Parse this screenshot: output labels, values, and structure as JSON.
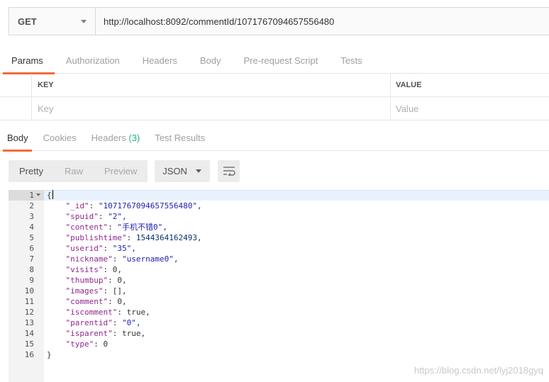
{
  "request": {
    "method": "GET",
    "url": "http://localhost:8092/commentId/1071767094657556480"
  },
  "request_tabs": [
    "Params",
    "Authorization",
    "Headers",
    "Body",
    "Pre-request Script",
    "Tests"
  ],
  "params_table": {
    "key_header": "KEY",
    "value_header": "VALUE",
    "key_placeholder": "Key",
    "value_placeholder": "Value"
  },
  "response_tabs": {
    "body": "Body",
    "cookies": "Cookies",
    "headers": "Headers",
    "headers_count": "(3)",
    "test_results": "Test Results"
  },
  "view_modes": [
    "Pretty",
    "Raw",
    "Preview"
  ],
  "format": "JSON",
  "response_lines": [
    {
      "n": "1",
      "k": "",
      "v": "{",
      "t": "p"
    },
    {
      "n": "2",
      "k": "\"_id\"",
      "v": "\"1071767094657556480\",",
      "t": "s"
    },
    {
      "n": "3",
      "k": "\"spuid\"",
      "v": "\"2\",",
      "t": "s"
    },
    {
      "n": "4",
      "k": "\"content\"",
      "v": "\"手机不错0\",",
      "t": "s"
    },
    {
      "n": "5",
      "k": "\"publishtime\"",
      "v": "1544364162493,",
      "t": "n"
    },
    {
      "n": "6",
      "k": "\"userid\"",
      "v": "\"35\",",
      "t": "s"
    },
    {
      "n": "7",
      "k": "\"nickname\"",
      "v": "\"username0\",",
      "t": "s"
    },
    {
      "n": "8",
      "k": "\"visits\"",
      "v": "0,",
      "t": "p"
    },
    {
      "n": "9",
      "k": "\"thumbup\"",
      "v": "0,",
      "t": "p"
    },
    {
      "n": "10",
      "k": "\"images\"",
      "v": "[],",
      "t": "p"
    },
    {
      "n": "11",
      "k": "\"comment\"",
      "v": "0,",
      "t": "p"
    },
    {
      "n": "12",
      "k": "\"iscomment\"",
      "v": "true,",
      "t": "p"
    },
    {
      "n": "13",
      "k": "\"parentid\"",
      "v": "\"0\",",
      "t": "s"
    },
    {
      "n": "14",
      "k": "\"isparent\"",
      "v": "true,",
      "t": "p"
    },
    {
      "n": "15",
      "k": "\"type\"",
      "v": "0",
      "t": "p"
    },
    {
      "n": "16",
      "k": "",
      "v": "}",
      "t": "p"
    }
  ],
  "watermark": "https://blog.csdn.net/lyj2018gyq",
  "colors": {
    "accent": "#f26b3a",
    "count_green": "#26b47f",
    "json_key": "#92278f",
    "json_string": "#1f21b5",
    "json_number": "#0a3069"
  }
}
